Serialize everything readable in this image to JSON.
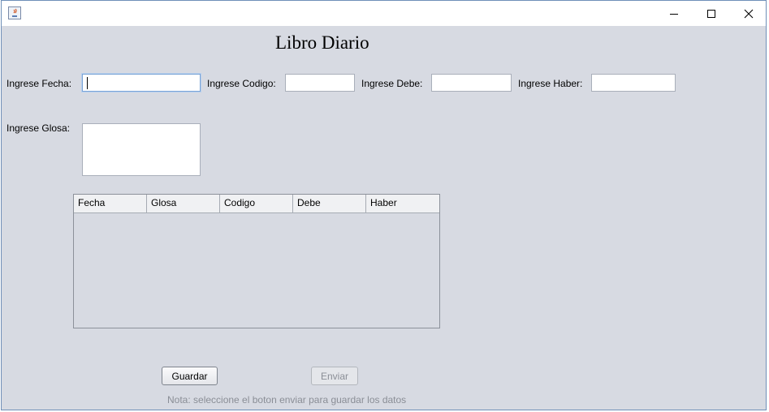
{
  "window": {
    "title": "",
    "controls": {
      "minimize": "minimize",
      "maximize": "maximize",
      "close": "close"
    }
  },
  "form": {
    "heading": "Libro Diario",
    "fecha": {
      "label": "Ingrese Fecha:",
      "value": ""
    },
    "codigo": {
      "label": "Ingrese Codigo:",
      "value": ""
    },
    "debe": {
      "label": "Ingrese Debe:",
      "value": ""
    },
    "haber": {
      "label": "Ingrese Haber:",
      "value": ""
    },
    "glosa": {
      "label": "Ingrese Glosa:",
      "value": ""
    }
  },
  "table": {
    "columns": [
      "Fecha",
      "Glosa",
      "Codigo",
      "Debe",
      "Haber"
    ],
    "rows": []
  },
  "buttons": {
    "save_label": "Guardar",
    "send_label": "Enviar",
    "send_enabled": false
  },
  "note": "Nota: seleccione el boton enviar para guardar los datos"
}
